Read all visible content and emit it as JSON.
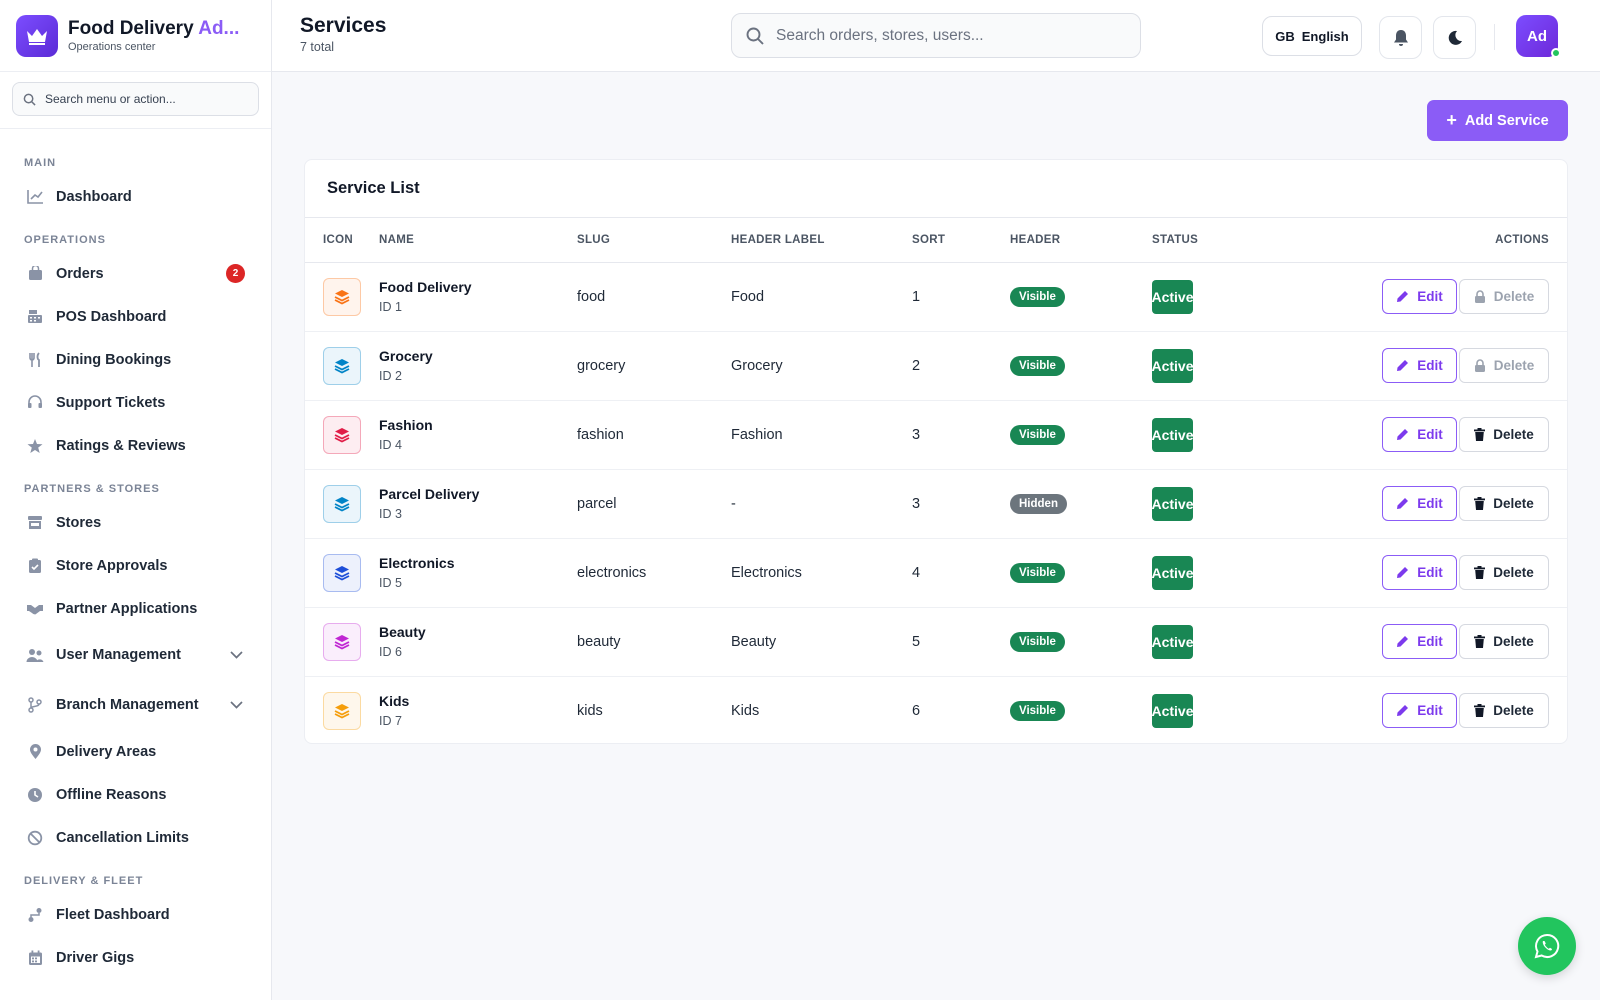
{
  "brand": {
    "title_main": "Food Delivery ",
    "title_accent": "Ad...",
    "subtitle": "Operations center"
  },
  "sidebar": {
    "search_placeholder": "Search menu or action...",
    "sections": {
      "main": "MAIN",
      "operations": "OPERATIONS",
      "partners": "PARTNERS & STORES",
      "delivery": "DELIVERY & FLEET"
    },
    "items": {
      "dashboard": "Dashboard",
      "orders": "Orders",
      "orders_badge": "2",
      "pos": "POS Dashboard",
      "dining": "Dining Bookings",
      "support": "Support Tickets",
      "ratings": "Ratings & Reviews",
      "stores": "Stores",
      "approvals": "Store Approvals",
      "partner_apps": "Partner Applications",
      "user_mgmt": "User Management",
      "branch_mgmt": "Branch Management",
      "delivery_areas": "Delivery Areas",
      "offline": "Offline Reasons",
      "cancel_limits": "Cancellation Limits",
      "fleet": "Fleet Dashboard",
      "driver_gigs": "Driver Gigs"
    }
  },
  "header": {
    "title": "Services",
    "count": "7 total",
    "search_placeholder": "Search orders, stores, users...",
    "lang_flag": "GB",
    "lang_label": "English",
    "avatar_initials": "Ad"
  },
  "actions": {
    "add_label": "Add Service"
  },
  "table": {
    "title": "Service List",
    "columns": {
      "icon": "ICON",
      "name": "NAME",
      "slug": "SLUG",
      "header_label": "HEADER LABEL",
      "sort": "SORT",
      "header": "HEADER",
      "status": "STATUS",
      "actions": "ACTIONS"
    },
    "edit_label": "Edit",
    "delete_label": "Delete",
    "rows": [
      {
        "name": "Food Delivery",
        "id": "ID 1",
        "slug": "food",
        "header_label": "Food",
        "sort": "1",
        "header": "Visible",
        "status": "Active",
        "icon_color": "#f97316",
        "delete_disabled": true
      },
      {
        "name": "Grocery",
        "id": "ID 2",
        "slug": "grocery",
        "header_label": "Grocery",
        "sort": "2",
        "header": "Visible",
        "status": "Active",
        "icon_color": "#0284c7",
        "delete_disabled": true
      },
      {
        "name": "Fashion",
        "id": "ID 4",
        "slug": "fashion",
        "header_label": "Fashion",
        "sort": "3",
        "header": "Visible",
        "status": "Active",
        "icon_color": "#e11d48",
        "delete_disabled": false
      },
      {
        "name": "Parcel Delivery",
        "id": "ID 3",
        "slug": "parcel",
        "header_label": "-",
        "sort": "3",
        "header": "Hidden",
        "status": "Active",
        "icon_color": "#0284c7",
        "delete_disabled": false
      },
      {
        "name": "Electronics",
        "id": "ID 5",
        "slug": "electronics",
        "header_label": "Electronics",
        "sort": "4",
        "header": "Visible",
        "status": "Active",
        "icon_color": "#1d4ed8",
        "delete_disabled": false
      },
      {
        "name": "Beauty",
        "id": "ID 6",
        "slug": "beauty",
        "header_label": "Beauty",
        "sort": "5",
        "header": "Visible",
        "status": "Active",
        "icon_color": "#c026d3",
        "delete_disabled": false
      },
      {
        "name": "Kids",
        "id": "ID 7",
        "slug": "kids",
        "header_label": "Kids",
        "sort": "6",
        "header": "Visible",
        "status": "Active",
        "icon_color": "#f59e0b",
        "delete_disabled": false
      }
    ]
  }
}
